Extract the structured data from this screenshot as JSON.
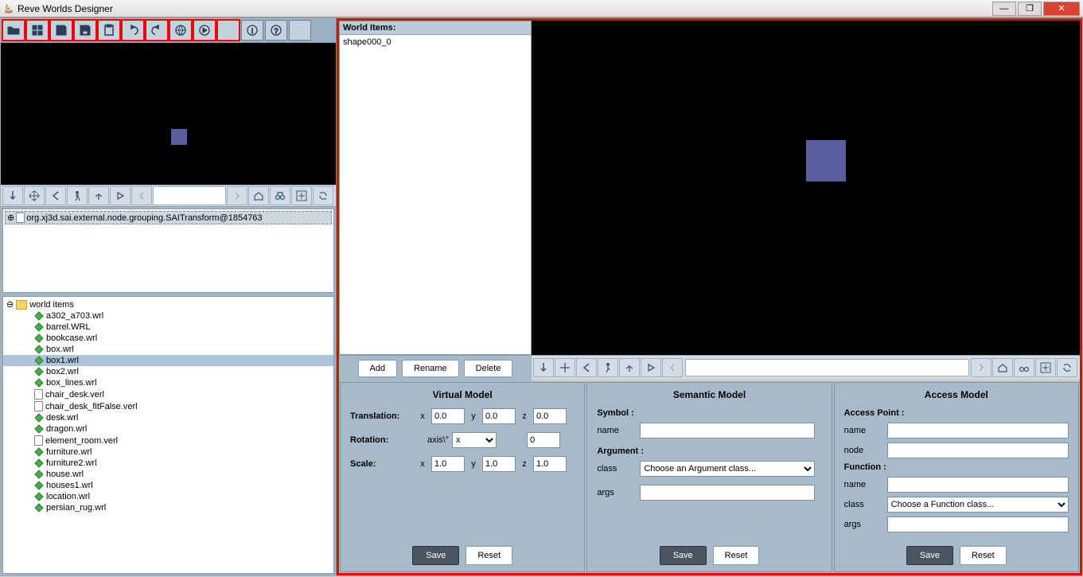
{
  "window": {
    "title": "Reve Worlds Designer"
  },
  "worldItems": {
    "header": "World Items:",
    "items": [
      "shape000_0"
    ],
    "addBtn": "Add",
    "renameBtn": "Rename",
    "deleteBtn": "Delete"
  },
  "treeNode": "org.xj3d.sai.external.node.grouping.SAITransform@1854763",
  "fileTree": {
    "root": "world items",
    "files": [
      {
        "name": "a302_a703.wrl",
        "type": "wrl"
      },
      {
        "name": "barrel.WRL",
        "type": "wrl"
      },
      {
        "name": "bookcase.wrl",
        "type": "wrl"
      },
      {
        "name": "box.wrl",
        "type": "wrl"
      },
      {
        "name": "box1.wrl",
        "type": "wrl",
        "selected": true
      },
      {
        "name": "box2.wrl",
        "type": "wrl"
      },
      {
        "name": "box_lines.wrl",
        "type": "wrl"
      },
      {
        "name": "chair_desk.verl",
        "type": "verl"
      },
      {
        "name": "chair_desk_fitFalse.verl",
        "type": "verl"
      },
      {
        "name": "desk.wrl",
        "type": "wrl"
      },
      {
        "name": "dragon.wrl",
        "type": "wrl"
      },
      {
        "name": "element_room.verl",
        "type": "verl"
      },
      {
        "name": "furniture.wrl",
        "type": "wrl"
      },
      {
        "name": "furniture2.wrl",
        "type": "wrl"
      },
      {
        "name": "house.wrl",
        "type": "wrl"
      },
      {
        "name": "houses1.wrl",
        "type": "wrl"
      },
      {
        "name": "location.wrl",
        "type": "wrl"
      },
      {
        "name": "persian_rug.wrl",
        "type": "wrl"
      }
    ]
  },
  "virtualModel": {
    "title": "Virtual Model",
    "translationLabel": "Translation:",
    "rotationLabel": "Rotation:",
    "scaleLabel": "Scale:",
    "axisLabel": "axis\\°",
    "t": {
      "x": "0.0",
      "y": "0.0",
      "z": "0.0"
    },
    "rotAxis": "x",
    "rotAngle": "0",
    "s": {
      "x": "1.0",
      "y": "1.0",
      "z": "1.0"
    },
    "save": "Save",
    "reset": "Reset"
  },
  "semanticModel": {
    "title": "Semantic Model",
    "symbolLabel": "Symbol :",
    "nameLabel": "name",
    "argLabel": "Argument :",
    "classLabel": "class",
    "argsLabel": "args",
    "classPlaceholder": "Choose an Argument class...",
    "save": "Save",
    "reset": "Reset"
  },
  "accessModel": {
    "title": "Access Model",
    "apLabel": "Access Point :",
    "nameLabel": "name",
    "nodeLabel": "node",
    "fnLabel": "Function :",
    "classLabel": "class",
    "argsLabel": "args",
    "classPlaceholder": "Choose a Function class...",
    "save": "Save",
    "reset": "Reset"
  }
}
